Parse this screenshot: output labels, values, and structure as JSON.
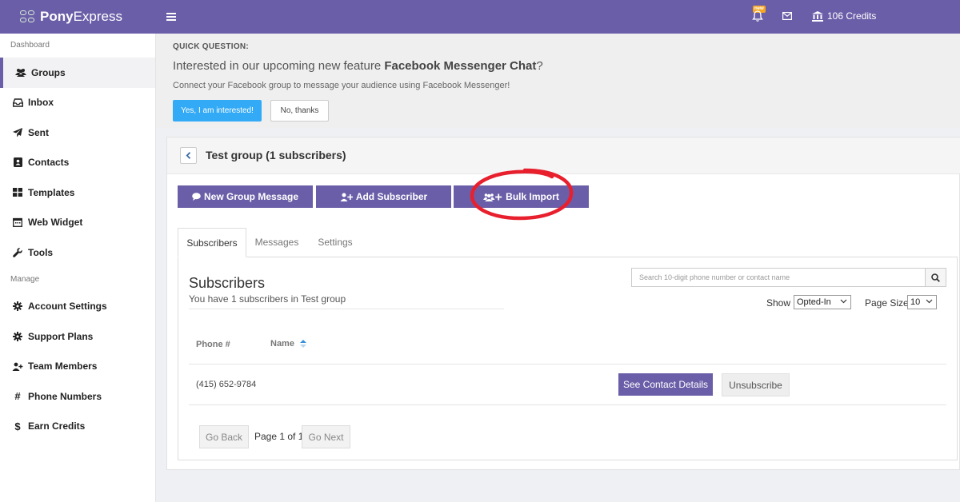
{
  "topbar": {
    "brand_bold": "Pony",
    "brand_light": "Express",
    "new_badge": "new",
    "credits": "106 Credits"
  },
  "sidebar": {
    "sections": [
      "Dashboard",
      "Manage"
    ],
    "items": [
      {
        "label": "Groups",
        "icon": "users-icon"
      },
      {
        "label": "Inbox",
        "icon": "inbox-icon"
      },
      {
        "label": "Sent",
        "icon": "paper-plane-icon"
      },
      {
        "label": "Contacts",
        "icon": "address-book-icon"
      },
      {
        "label": "Templates",
        "icon": "th-large-icon"
      },
      {
        "label": "Web Widget",
        "icon": "calendar-widget-icon"
      },
      {
        "label": "Tools",
        "icon": "wrench-icon"
      },
      {
        "label": "Account Settings",
        "icon": "gear-icon"
      },
      {
        "label": "Support Plans",
        "icon": "gear-icon"
      },
      {
        "label": "Team Members",
        "icon": "user-plus-icon"
      },
      {
        "label": "Phone Numbers",
        "icon": "hash-icon"
      },
      {
        "label": "Earn Credits",
        "icon": "dollar-icon"
      }
    ]
  },
  "quick_question": {
    "label": "QUICK QUESTION:",
    "title_prefix": "Interested in our upcoming new feature ",
    "title_feature": "Facebook Messenger Chat",
    "title_suffix": "?",
    "subtitle": "Connect your Facebook group to message your audience using Facebook Messenger!",
    "yes_label": "Yes, I am interested!",
    "no_label": "No, thanks"
  },
  "group": {
    "title": "Test group (1 subscribers)",
    "actions": {
      "new_message": "New Group Message",
      "add_subscriber": "Add Subscriber",
      "bulk_import": "Bulk Import"
    },
    "tabs": [
      "Subscribers",
      "Messages",
      "Settings"
    ],
    "active_tab": "Subscribers"
  },
  "subscribers": {
    "title": "Subscribers",
    "description": "You have 1 subscribers in Test group",
    "search_placeholder": "Search 10-digit phone number or contact name",
    "show_label": "Show",
    "show_value": "Opted-In",
    "page_size_label": "Page Size",
    "page_size_value": "10",
    "columns": [
      "Phone #",
      "Name"
    ],
    "rows": [
      {
        "phone": "(415) 652-9784",
        "name": ""
      }
    ],
    "details_label": "See Contact Details",
    "unsubscribe_label": "Unsubscribe"
  },
  "pagination": {
    "back_label": "Go Back",
    "page_text": "Page 1 of 1",
    "next_label": "Go Next"
  }
}
